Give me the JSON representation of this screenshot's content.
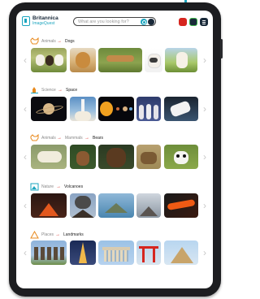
{
  "brand": {
    "name": "Britannica",
    "product": "ImageQuest"
  },
  "search": {
    "placeholder": "What are you looking for?"
  },
  "colors": {
    "accent": "#1ba5bf",
    "crumb_arrow": "#d6261f",
    "bezel": "#1c1d20"
  },
  "rows": [
    {
      "icon": "dog-icon",
      "crumbs": [
        "Animals",
        "Dogs"
      ],
      "images": [
        "puppies",
        "golden-retriever",
        "running-dog",
        "french-bulldog",
        "jack-russell-terrier"
      ]
    },
    {
      "icon": "rocket-icon",
      "crumbs": [
        "Science",
        "Space"
      ],
      "images": [
        "saturn",
        "shuttle-launch",
        "solar-system",
        "astronauts",
        "spacewalk"
      ]
    },
    {
      "icon": "paw-icon",
      "crumbs": [
        "Animals",
        "Mammals",
        "Bears"
      ],
      "images": [
        "polar-bear",
        "brown-bear-cub",
        "grizzly-bear",
        "brown-bear-grass",
        "panda"
      ]
    },
    {
      "icon": "mountain-icon",
      "crumbs": [
        "Nature",
        "Volcanoes"
      ],
      "images": [
        "erupting-volcano",
        "ash-plume",
        "volcanic-island",
        "volcano-smoke",
        "lava-flow"
      ]
    },
    {
      "icon": "pyramid-icon",
      "crumbs": [
        "Places",
        "Landmarks"
      ],
      "images": [
        "easter-island",
        "eiffel-tower",
        "parthenon",
        "torii-gate",
        "pyramids"
      ]
    }
  ]
}
